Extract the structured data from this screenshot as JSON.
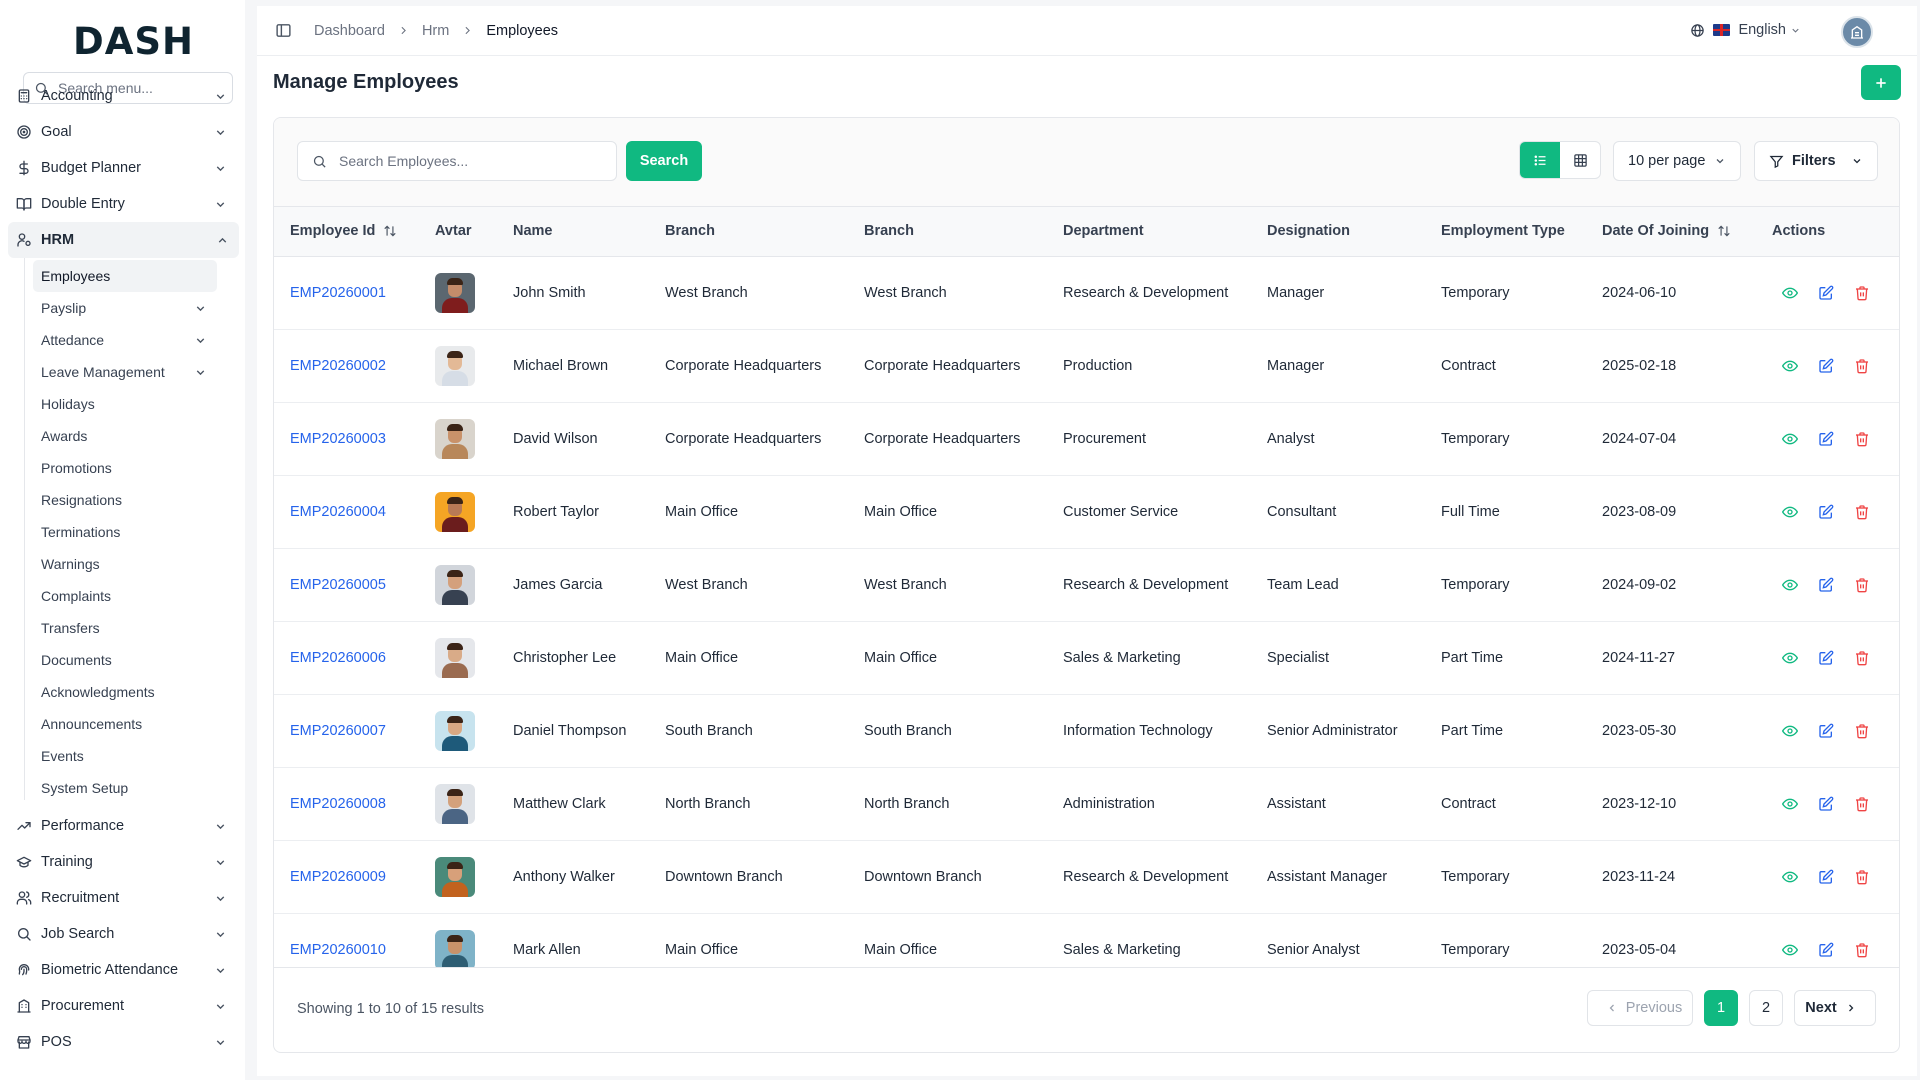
{
  "brand": {
    "logo_text": "DASH"
  },
  "sidebar": {
    "search_placeholder": "Search menu...",
    "items_top": [
      {
        "label": "Accounting",
        "icon": "calculator-icon"
      },
      {
        "label": "Goal",
        "icon": "target-icon"
      },
      {
        "label": "Budget Planner",
        "icon": "dollar-icon"
      },
      {
        "label": "Double Entry",
        "icon": "book-open-icon"
      }
    ],
    "hrm": {
      "label": "HRM",
      "sub": [
        {
          "label": "Employees",
          "active": true
        },
        {
          "label": "Payslip",
          "chevron": true
        },
        {
          "label": "Attedance",
          "chevron": true
        },
        {
          "label": "Leave Management",
          "chevron": true
        },
        {
          "label": "Holidays"
        },
        {
          "label": "Awards"
        },
        {
          "label": "Promotions"
        },
        {
          "label": "Resignations"
        },
        {
          "label": "Terminations"
        },
        {
          "label": "Warnings"
        },
        {
          "label": "Complaints"
        },
        {
          "label": "Transfers"
        },
        {
          "label": "Documents"
        },
        {
          "label": "Acknowledgments"
        },
        {
          "label": "Announcements"
        },
        {
          "label": "Events"
        },
        {
          "label": "System Setup"
        }
      ]
    },
    "items_bottom": [
      {
        "label": "Performance",
        "icon": "trending-up-icon"
      },
      {
        "label": "Training",
        "icon": "graduation-cap-icon"
      },
      {
        "label": "Recruitment",
        "icon": "users-icon"
      },
      {
        "label": "Job Search",
        "icon": "search-icon"
      },
      {
        "label": "Biometric Attendance",
        "icon": "fingerprint-icon"
      },
      {
        "label": "Procurement",
        "icon": "building-icon"
      },
      {
        "label": "POS",
        "icon": "store-icon"
      }
    ]
  },
  "topbar": {
    "breadcrumb": [
      "Dashboard",
      "Hrm",
      "Employees"
    ],
    "language": "English"
  },
  "page": {
    "title": "Manage Employees",
    "search_placeholder": "Search Employees...",
    "search_button": "Search",
    "per_page": "10 per page",
    "filters": "Filters"
  },
  "table": {
    "headers": [
      "Employee Id",
      "Avtar",
      "Name",
      "Branch",
      "Branch",
      "Department",
      "Designation",
      "Employment Type",
      "Date Of Joining",
      "Actions"
    ],
    "rows": [
      {
        "id": "EMP20260001",
        "name": "John Smith",
        "branch": "West Branch",
        "branch2": "West Branch",
        "department": "Research & Development",
        "designation": "Manager",
        "type": "Temporary",
        "date": "2024-06-10",
        "avatar_bg": "#5b6770",
        "shirt": "#7f1d1d",
        "skin": "#c48c6a"
      },
      {
        "id": "EMP20260002",
        "name": "Michael Brown",
        "branch": "Corporate Headquarters",
        "branch2": "Corporate Headquarters",
        "department": "Production",
        "designation": "Manager",
        "type": "Contract",
        "date": "2025-02-18",
        "avatar_bg": "#e8eaec",
        "shirt": "#d6dde6",
        "skin": "#e3b996"
      },
      {
        "id": "EMP20260003",
        "name": "David Wilson",
        "branch": "Corporate Headquarters",
        "branch2": "Corporate Headquarters",
        "department": "Procurement",
        "designation": "Analyst",
        "type": "Temporary",
        "date": "2024-07-04",
        "avatar_bg": "#d9d4cc",
        "shirt": "#b8875a",
        "skin": "#c9926a"
      },
      {
        "id": "EMP20260004",
        "name": "Robert Taylor",
        "branch": "Main Office",
        "branch2": "Main Office",
        "department": "Customer Service",
        "designation": "Consultant",
        "type": "Full Time",
        "date": "2023-08-09",
        "avatar_bg": "#f5a524",
        "shirt": "#6b1d1d",
        "skin": "#b87a56"
      },
      {
        "id": "EMP20260005",
        "name": "James Garcia",
        "branch": "West Branch",
        "branch2": "West Branch",
        "department": "Research & Development",
        "designation": "Team Lead",
        "type": "Temporary",
        "date": "2024-09-02",
        "avatar_bg": "#d1d5db",
        "shirt": "#374151",
        "skin": "#d4a07c"
      },
      {
        "id": "EMP20260006",
        "name": "Christopher Lee",
        "branch": "Main Office",
        "branch2": "Main Office",
        "department": "Sales & Marketing",
        "designation": "Specialist",
        "type": "Part Time",
        "date": "2024-11-27",
        "avatar_bg": "#e5e7eb",
        "shirt": "#9a6b50",
        "skin": "#d9ab88"
      },
      {
        "id": "EMP20260007",
        "name": "Daniel Thompson",
        "branch": "South Branch",
        "branch2": "South Branch",
        "department": "Information Technology",
        "designation": "Senior Administrator",
        "type": "Part Time",
        "date": "2023-05-30",
        "avatar_bg": "#c7e3ee",
        "shirt": "#1e5a7a",
        "skin": "#d9a883"
      },
      {
        "id": "EMP20260008",
        "name": "Matthew Clark",
        "branch": "North Branch",
        "branch2": "North Branch",
        "department": "Administration",
        "designation": "Assistant",
        "type": "Contract",
        "date": "2023-12-10",
        "avatar_bg": "#dfe3e8",
        "shirt": "#4b6584",
        "skin": "#d3a17c"
      },
      {
        "id": "EMP20260009",
        "name": "Anthony Walker",
        "branch": "Downtown Branch",
        "branch2": "Downtown Branch",
        "department": "Research & Development",
        "designation": "Assistant Manager",
        "type": "Temporary",
        "date": "2023-11-24",
        "avatar_bg": "#4a8a7a",
        "shirt": "#c2621e",
        "skin": "#d7a07a"
      },
      {
        "id": "EMP20260010",
        "name": "Mark Allen",
        "branch": "Main Office",
        "branch2": "Main Office",
        "department": "Sales & Marketing",
        "designation": "Senior Analyst",
        "type": "Temporary",
        "date": "2023-05-04",
        "avatar_bg": "#7fb3c8",
        "shirt": "#2d5d73",
        "skin": "#c9926a"
      }
    ]
  },
  "pagination": {
    "summary": "Showing 1 to 10 of 15 results",
    "previous": "Previous",
    "pages": [
      "1",
      "2"
    ],
    "current": "1",
    "next": "Next"
  },
  "colors": {
    "accent": "#10b981",
    "link": "#2563eb",
    "danger": "#ef4444"
  }
}
